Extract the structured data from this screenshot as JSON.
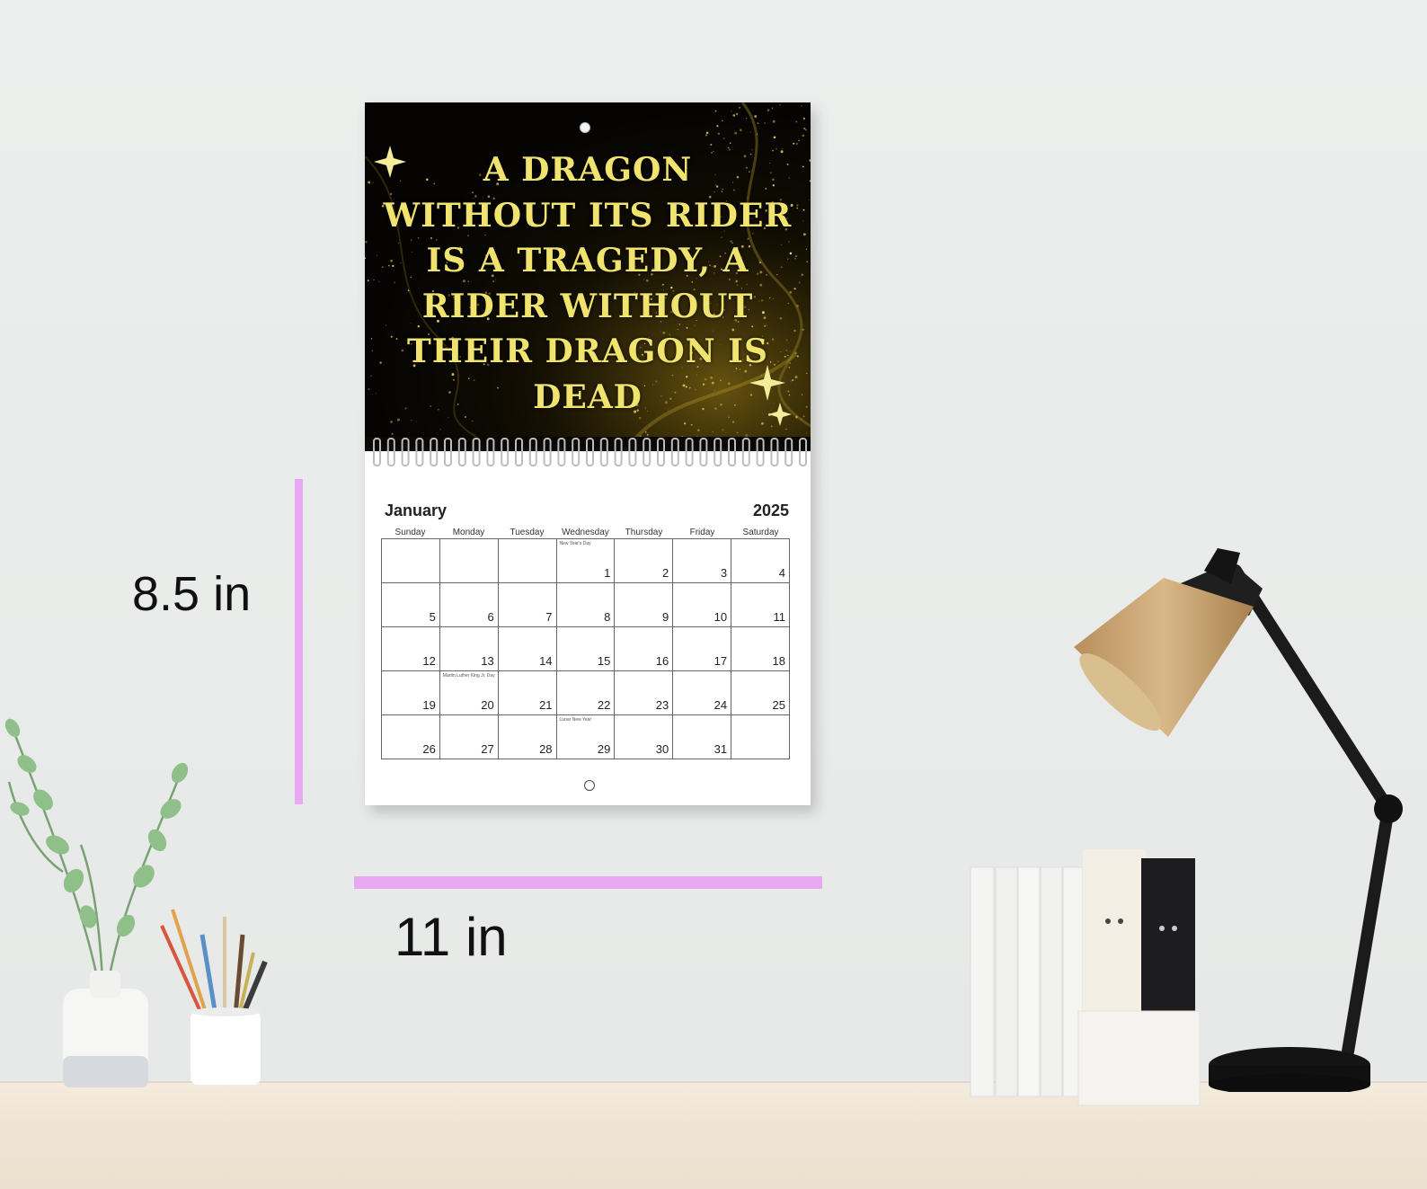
{
  "calendar": {
    "quote": "A DRAGON WITHOUT ITS RIDER IS A TRAGEDY, A RIDER WITHOUT THEIR DRAGON IS DEAD",
    "month": "January",
    "year": "2025",
    "weekdays": [
      "Sunday",
      "Monday",
      "Tuesday",
      "Wednesday",
      "Thursday",
      "Friday",
      "Saturday"
    ],
    "weeks": [
      [
        "",
        "",
        "",
        "1",
        "2",
        "3",
        "4"
      ],
      [
        "5",
        "6",
        "7",
        "8",
        "9",
        "10",
        "11"
      ],
      [
        "12",
        "13",
        "14",
        "15",
        "16",
        "17",
        "18"
      ],
      [
        "19",
        "20",
        "21",
        "22",
        "23",
        "24",
        "25"
      ],
      [
        "26",
        "27",
        "28",
        "29",
        "30",
        "31",
        ""
      ]
    ],
    "notes": [
      {
        "week": 0,
        "day": 3,
        "text": "New Year's Day"
      },
      {
        "week": 3,
        "day": 1,
        "text": "Martin Luther King Jr. Day"
      },
      {
        "week": 4,
        "day": 3,
        "text": "Lunar New Year"
      }
    ]
  },
  "dimensions": {
    "height": "8.5 in",
    "width": "11 in"
  },
  "colors": {
    "quote_text": "#f0e46e",
    "measure_bar": "#e8a8f2",
    "cover_bg": "#050403"
  }
}
